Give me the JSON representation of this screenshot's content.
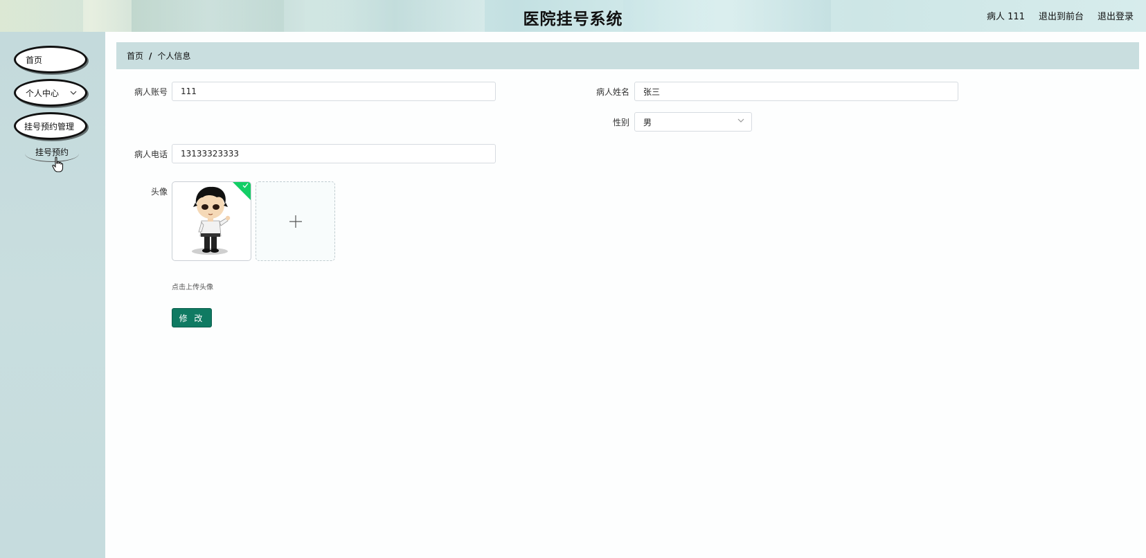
{
  "header": {
    "title": "医院挂号系统",
    "user_label": "病人 111",
    "back_to_front": "退出到前台",
    "logout": "退出登录"
  },
  "sidebar": {
    "items": [
      {
        "label": "首页",
        "has_children": false
      },
      {
        "label": "个人中心",
        "has_children": true,
        "icon": "chevron-down-icon"
      },
      {
        "label": "挂号预约管理",
        "has_children": true
      }
    ],
    "submenu": {
      "label": "挂号预约"
    }
  },
  "breadcrumb": {
    "home": "首页",
    "separator": "/",
    "current": "个人信息"
  },
  "form": {
    "account": {
      "label": "病人账号",
      "value": "111"
    },
    "name": {
      "label": "病人姓名",
      "value": "张三"
    },
    "gender": {
      "label": "性别",
      "value": "男",
      "icon": "chevron-down-icon"
    },
    "phone": {
      "label": "病人电话",
      "value": "13133323333"
    },
    "avatar": {
      "label": "头像",
      "upload_hint": "点击上传头像",
      "upload_icon": "plus-icon",
      "status_icon": "check-icon"
    },
    "submit_label": "修 改"
  },
  "colors": {
    "accent": "#0f7a62",
    "sidebar_bg": "#c6dcde",
    "breadcrumb_bg": "#c9dedf",
    "success": "#13ce66"
  }
}
